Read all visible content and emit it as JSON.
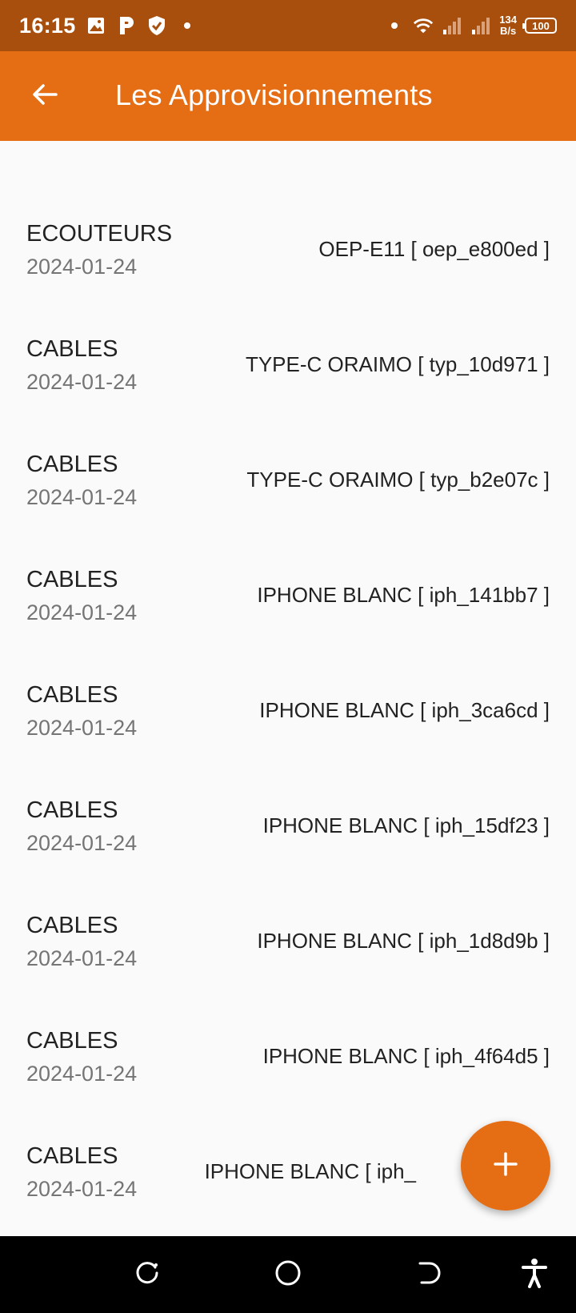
{
  "status_bar": {
    "time": "16:15",
    "net_speed_value": "134",
    "net_speed_unit": "B/s",
    "battery": "100"
  },
  "app_bar": {
    "title": "Les Approvisionnements"
  },
  "items": [
    {
      "category": "ECOUTEURS",
      "date": "2024-01-24",
      "product": "OEP-E11 [ oep_e800ed ]"
    },
    {
      "category": "CABLES",
      "date": "2024-01-24",
      "product": "TYPE-C ORAIMO [ typ_10d971 ]"
    },
    {
      "category": "CABLES",
      "date": "2024-01-24",
      "product": "TYPE-C ORAIMO [ typ_b2e07c ]"
    },
    {
      "category": "CABLES",
      "date": "2024-01-24",
      "product": "IPHONE BLANC [ iph_141bb7 ]"
    },
    {
      "category": "CABLES",
      "date": "2024-01-24",
      "product": "IPHONE BLANC [ iph_3ca6cd ]"
    },
    {
      "category": "CABLES",
      "date": "2024-01-24",
      "product": "IPHONE BLANC [ iph_15df23 ]"
    },
    {
      "category": "CABLES",
      "date": "2024-01-24",
      "product": "IPHONE BLANC [ iph_1d8d9b ]"
    },
    {
      "category": "CABLES",
      "date": "2024-01-24",
      "product": "IPHONE BLANC [ iph_4f64d5 ]"
    },
    {
      "category": "CABLES",
      "date": "2024-01-24",
      "product": "IPHONE BLANC [ iph_"
    }
  ],
  "colors": {
    "status_bar": "#a94f0d",
    "app_bar": "#e56d14",
    "fab": "#e56d14",
    "background": "#fafafa"
  },
  "icons": {
    "back": "arrow-left-icon",
    "fab": "plus-icon",
    "nav_recents": "recents-icon",
    "nav_home": "home-icon",
    "nav_back": "back-icon",
    "nav_accessibility": "accessibility-icon"
  }
}
